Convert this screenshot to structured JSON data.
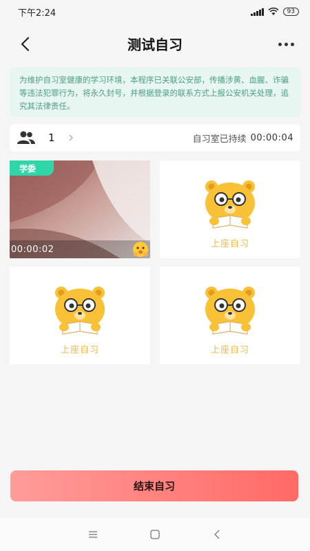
{
  "status_bar": {
    "time": "下午2:24",
    "battery": "93",
    "icons": [
      "signal-icon",
      "wifi-icon",
      "battery-icon"
    ]
  },
  "header": {
    "title": "测试自习",
    "back_icon": "back-chevron-icon",
    "more_icon": "more-dots-icon"
  },
  "notice": {
    "text": "为维护自习室健康的学习环境，本程序已关联公安部，传播涉黄、血腥、诈骗等违法犯罪行为，将永久封号，并根据登录的联系方式上报公安机关处理，追究其法律责任。"
  },
  "info_bar": {
    "member_count": "1",
    "duration_label": "自习室已持续",
    "duration_time": "00:00:04"
  },
  "seats": [
    {
      "type": "camera",
      "badge": "学委",
      "timer": "00:00:02",
      "emoji_icon": "face-emoji-icon"
    },
    {
      "type": "empty",
      "label": "上座自习",
      "icon": "bear-reading-icon"
    },
    {
      "type": "empty",
      "label": "上座自习",
      "icon": "bear-reading-icon"
    },
    {
      "type": "empty",
      "label": "上座自习",
      "icon": "bear-reading-icon"
    }
  ],
  "end_button": {
    "label": "结束自习"
  },
  "nav_bar": {
    "icons": [
      "menu-icon",
      "home-icon",
      "back-icon"
    ]
  },
  "colors": {
    "accent_green": "#2fd6a8",
    "notice_text": "#4f9c88",
    "seat_label": "#f1b94a",
    "end_button_start": "#ff9c9a",
    "end_button_end": "#ff6a66"
  }
}
